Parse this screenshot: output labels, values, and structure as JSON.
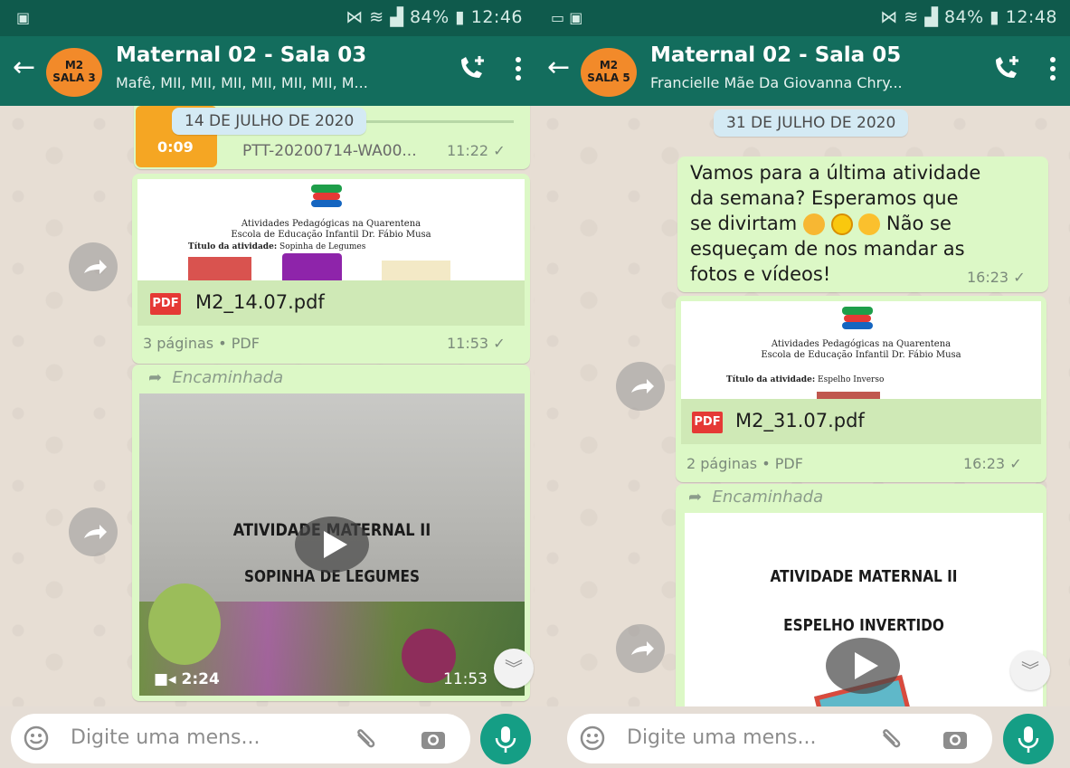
{
  "left": {
    "status": {
      "battery": "84%",
      "time": "12:46"
    },
    "header": {
      "avatar_line1": "M2",
      "avatar_line2": "SALA 3",
      "title": "Maternal 02 - Sala 03",
      "subtitle": "Mafê, MII, MII, MII, MII, MII, MII, M..."
    },
    "date_chip": "14 DE JULHO DE 2020",
    "audio": {
      "duration": "0:09",
      "filename": "PTT-20200714-WA00...",
      "time": "11:22"
    },
    "doc": {
      "preview_line1": "Atividades Pedagógicas na Quarentena",
      "preview_line2": "Escola de Educação Infantil Dr. Fábio Musa",
      "preview_title_label": "Título da atividade:",
      "preview_title_value": "Sopinha de Legumes",
      "pdf_icon": "PDF",
      "filename": "M2_14.07.pdf",
      "info": "3 páginas • PDF",
      "time": "11:53"
    },
    "video_msg": {
      "forwarded": "Encaminhada",
      "line1": "ATIVIDADE MATERNAL II",
      "line2": "SOPINHA DE LEGUMES",
      "duration": "2:24",
      "time": "11:53"
    },
    "input": {
      "placeholder": "Digite uma mens..."
    }
  },
  "right": {
    "status": {
      "battery": "84%",
      "time": "12:48"
    },
    "header": {
      "avatar_line1": "M2",
      "avatar_line2": "SALA 5",
      "title": "Maternal 02 - Sala 05",
      "subtitle": "Francielle Mãe Da Giovanna Chry..."
    },
    "date_chip": "31 DE JULHO DE 2020",
    "text_msg": {
      "line1": "Vamos para a última atividade",
      "line2": "da semana? Esperamos que",
      "line3a": "se divirtam",
      "line3b": "Não se",
      "line4": "esqueçam de nos mandar as",
      "line5": "fotos e vídeos!",
      "time": "16:23"
    },
    "doc": {
      "preview_line1": "Atividades Pedagógicas na Quarentena",
      "preview_line2": "Escola de Educação Infantil Dr. Fábio Musa",
      "preview_title_label": "Título da atividade:",
      "preview_title_value": "Espelho Inverso",
      "pdf_icon": "PDF",
      "filename": "M2_31.07.pdf",
      "info": "2 páginas • PDF",
      "time": "16:23"
    },
    "video_msg": {
      "forwarded": "Encaminhada",
      "line1": "ATIVIDADE MATERNAL II",
      "line2": "ESPELHO INVERTIDO"
    },
    "input": {
      "placeholder": "Digite uma mens..."
    }
  },
  "colors": {
    "header": "#136d5d",
    "statusbar": "#0f5a4c",
    "bubble": "#dcf8c6",
    "mic": "#159e85",
    "avatar": "#f28a2a"
  }
}
